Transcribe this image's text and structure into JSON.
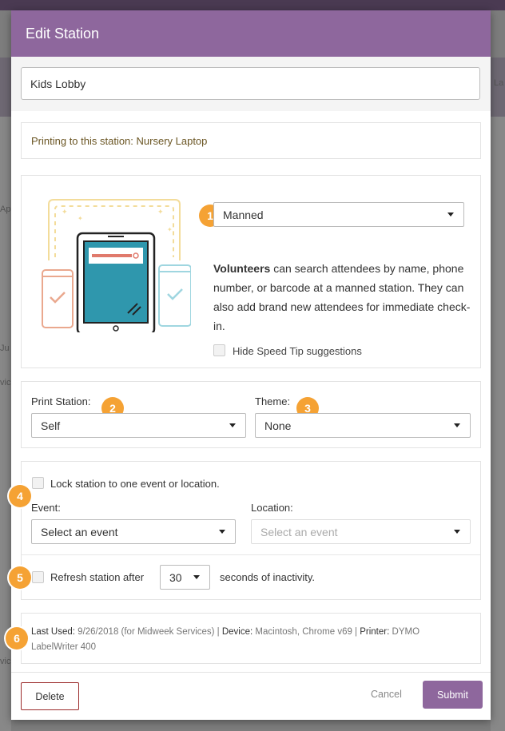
{
  "background_fragments": {
    "f1": "La",
    "f2": "Ap",
    "f3": "Ju",
    "f4": "vic",
    "f5": "vic"
  },
  "modal": {
    "title": "Edit Station",
    "station_name": "Kids Lobby",
    "printing_text": "Printing to this station: Nursery Laptop",
    "mode": {
      "badge": "1",
      "selected": "Manned",
      "desc_bold": "Volunteers",
      "desc_rest": " can search attendees by name, phone number, or barcode at a manned station. They can also add brand new attendees for immediate check-in.",
      "hide_tips_label": "Hide Speed Tip suggestions"
    },
    "print_station": {
      "label": "Print Station:",
      "badge": "2",
      "selected": "Self"
    },
    "theme": {
      "label": "Theme:",
      "badge": "3",
      "selected": "None"
    },
    "lock": {
      "badge": "4",
      "checkbox_label": "Lock station to one event or location.",
      "event_label": "Event:",
      "event_selected": "Select an event",
      "location_label": "Location:",
      "location_placeholder": "Select an event"
    },
    "refresh": {
      "badge": "5",
      "label_before": "Refresh station after",
      "seconds": "30",
      "label_after": "seconds of inactivity."
    },
    "meta": {
      "badge": "6",
      "last_used_key": "Last Used:",
      "last_used_val": " 9/26/2018 (for Midweek Services) | ",
      "device_key": "Device:",
      "device_val": " Macintosh, Chrome v69 | ",
      "printer_key": "Printer:",
      "printer_val": " DYMO LabelWriter 400"
    },
    "footer": {
      "delete": "Delete",
      "cancel": "Cancel",
      "submit": "Submit"
    }
  },
  "colors": {
    "header": "#8e679d",
    "badge": "#f5a234",
    "tablet_screen": "#2f97ad"
  }
}
